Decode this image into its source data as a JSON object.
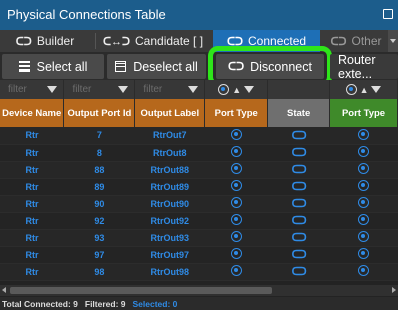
{
  "window": {
    "title": "Physical Connections Table"
  },
  "tabs": [
    {
      "glyph": "ᑕᑐ",
      "label": "Builder"
    },
    {
      "glyph": "ᑕ↔ᑐ",
      "label": "Candidate [ ]"
    },
    {
      "glyph": "ᑕᑐ",
      "label": "Connected"
    },
    {
      "glyph": "ᑕᑐ",
      "label": "Other"
    }
  ],
  "actions": {
    "select_all": "Select all",
    "deselect_all": "Deselect all",
    "disconnect": "Disconnect",
    "disconnect_glyph": "ᑕᑐ",
    "router_ext": "Router exte..."
  },
  "filters": {
    "placeholder": "filter"
  },
  "columns": {
    "device_name": "Device Name",
    "output_port_id": "Output Port Id",
    "output_label": "Output Label",
    "port_type": "Port Type",
    "state": "State",
    "port_type_right": "Port Type"
  },
  "rows": [
    {
      "device": "Rtr",
      "port": "7",
      "label": "RtrOut7"
    },
    {
      "device": "Rtr",
      "port": "8",
      "label": "RtrOut8"
    },
    {
      "device": "Rtr",
      "port": "88",
      "label": "RtrOut88"
    },
    {
      "device": "Rtr",
      "port": "89",
      "label": "RtrOut89"
    },
    {
      "device": "Rtr",
      "port": "90",
      "label": "RtrOut90"
    },
    {
      "device": "Rtr",
      "port": "92",
      "label": "RtrOut92"
    },
    {
      "device": "Rtr",
      "port": "93",
      "label": "RtrOut93"
    },
    {
      "device": "Rtr",
      "port": "97",
      "label": "RtrOut97"
    },
    {
      "device": "Rtr",
      "port": "98",
      "label": "RtrOut98"
    }
  ],
  "link_glyph": "ᑕᑐ",
  "status": {
    "total": "Total Connected: 9",
    "filtered": "Filtered: 9",
    "selected": "Selected: 0"
  },
  "colors": {
    "titlebar": "#1c5d8c",
    "active_tab": "#1e6fb6",
    "output_header": "#b6681c",
    "state_header": "#6f6f6f",
    "input_header": "#3f8a2a",
    "highlight": "#2ee51a",
    "link_blue": "#2f8be6"
  }
}
